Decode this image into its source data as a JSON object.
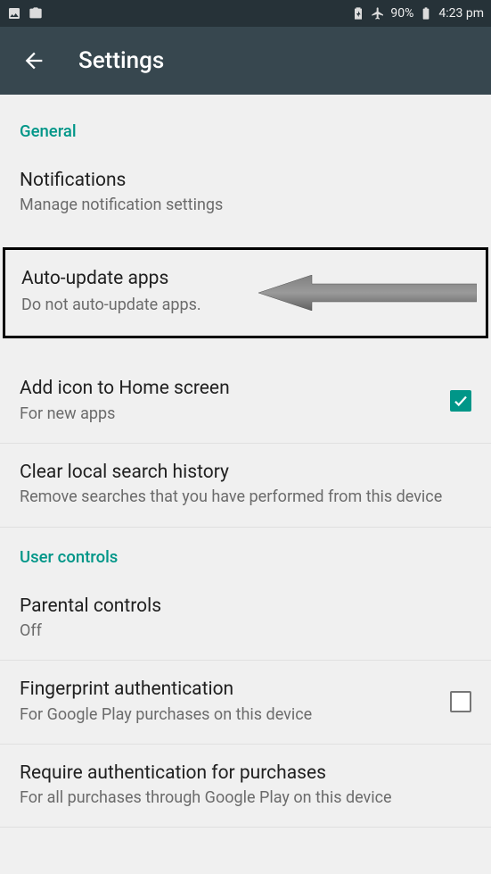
{
  "status": {
    "battery_pct": "90%",
    "time": "4:23 pm"
  },
  "appbar": {
    "title": "Settings"
  },
  "sections": {
    "general": {
      "header": "General",
      "notifications": {
        "title": "Notifications",
        "sub": "Manage notification settings"
      },
      "auto_update": {
        "title": "Auto-update apps",
        "sub": "Do not auto-update apps."
      },
      "add_icon": {
        "title": "Add icon to Home screen",
        "sub": "For new apps",
        "checked": true
      },
      "clear_history": {
        "title": "Clear local search history",
        "sub": "Remove searches that you have performed from this device"
      }
    },
    "user_controls": {
      "header": "User controls",
      "parental": {
        "title": "Parental controls",
        "sub": "Off"
      },
      "fingerprint": {
        "title": "Fingerprint authentication",
        "sub": "For Google Play purchases on this device",
        "checked": false
      },
      "require_auth": {
        "title": "Require authentication for purchases",
        "sub": "For all purchases through Google Play on this device"
      }
    }
  }
}
